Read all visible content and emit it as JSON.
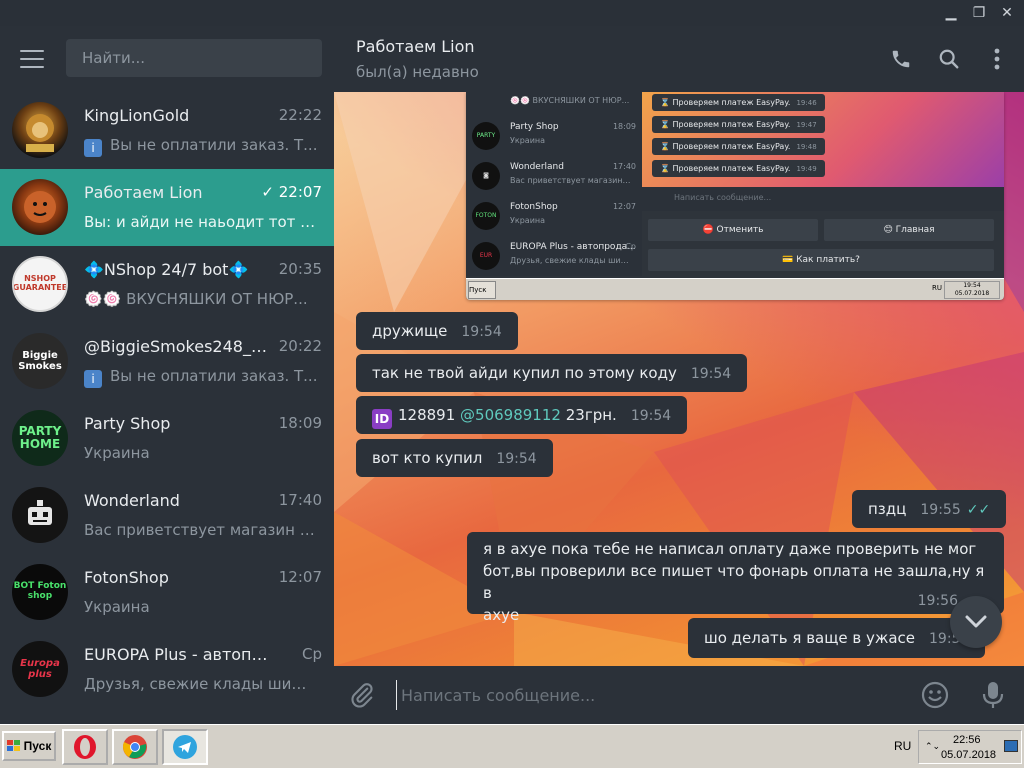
{
  "window": {
    "minimize": "▁",
    "maximize": "❐",
    "close": "✕"
  },
  "search": {
    "placeholder": "Найти..."
  },
  "chats": [
    {
      "name": "KingLionGold",
      "time": "22:22",
      "preview": "Вы не оплатили заказ. Т...",
      "badge": "i",
      "avatar_color": "#1a1410",
      "avatar_text": ""
    },
    {
      "name": "Работаем Lion",
      "time": "✓ 22:07",
      "preview": "Вы: и айди не наьодит тот чт...",
      "badge": "",
      "active": true,
      "avatar_color": "#3a1a0c",
      "avatar_text": ""
    },
    {
      "name": "💠NShop 24/7 bot💠",
      "time": "20:35",
      "preview": "🍥🍥 ВКУСНЯШКИ ОТ НЮР...",
      "badge": "",
      "avatar_color": "#f2f2f2",
      "avatar_text": "NSHOP GUARANTEE"
    },
    {
      "name": "@BiggieSmokes248_bot",
      "time": "20:22",
      "preview": "Вы не оплатили заказ. Т...",
      "badge": "i",
      "avatar_color": "#222222",
      "avatar_text": "Biggie Smokes"
    },
    {
      "name": "Party Shop",
      "time": "18:09",
      "preview": "Украина",
      "badge": "",
      "avatar_color": "#0f2a1a",
      "avatar_text": "PARTY HOME"
    },
    {
      "name": "Wonderland",
      "time": "17:40",
      "preview": "Вас приветствует магазин - ...",
      "badge": "",
      "avatar_color": "#0f0f0f",
      "avatar_text": ""
    },
    {
      "name": "FotonShop",
      "time": "12:07",
      "preview": "Украина",
      "badge": "",
      "avatar_color": "#0a0a0a",
      "avatar_text": "BOT Foton shop"
    },
    {
      "name": "EUROPA Plus - автопрода...",
      "time": "Ср",
      "preview": "Друзья, свежие клады шише...",
      "badge": "",
      "avatar_color": "#111111",
      "avatar_text": "Europa plus"
    }
  ],
  "header": {
    "title": "Работаем Lion",
    "status": "был(а) недавно"
  },
  "screenshot": {
    "list": [
      {
        "name": "",
        "sub": "🍥🍥 ВКУСНЯШКИ ОТ НЮР...",
        "time": ""
      },
      {
        "name": "Party Shop",
        "sub": "Украина",
        "time": "18:09"
      },
      {
        "name": "Wonderland",
        "sub": "Вас приветствует магазин - ...",
        "time": "17:40"
      },
      {
        "name": "FotonShop",
        "sub": "Украина",
        "time": "12:07"
      },
      {
        "name": "EUROPA Plus - автопрода...",
        "sub": "Друзья, свежие клады шише...",
        "time": "Ср"
      }
    ],
    "msgs": [
      {
        "text": "⌛ Проверяем платеж EasyPay.",
        "time": "19:46"
      },
      {
        "text": "⌛ Проверяем платеж EasyPay.",
        "time": "19:47"
      },
      {
        "text": "⌛ Проверяем платеж EasyPay.",
        "time": "19:48"
      },
      {
        "text": "⌛ Проверяем платеж EasyPay.",
        "time": "19:49"
      }
    ],
    "input_placeholder": "Написать сообщение...",
    "btn_cancel": "⛔ Отменить",
    "btn_main": "😊 Главная",
    "btn_pay": "💳 Как платить?",
    "tb_start": "Пуск",
    "tb_ru": "RU",
    "tb_time": "19:54",
    "tb_date": "05.07.2018"
  },
  "messages": [
    {
      "text": "дружище",
      "time": "19:54"
    },
    {
      "text": "так не твой айди купил по этому коду",
      "time": "19:54"
    },
    {
      "id_badge": "ID",
      "num": "128891",
      "mention": "@506989112",
      "suffix": "23грн.",
      "time": "19:54"
    },
    {
      "text": "вот кто купил",
      "time": "19:54"
    },
    {
      "text": "пздц",
      "time": "19:55",
      "out": true
    },
    {
      "line1": "я в ахуе пока тебе не написал оплату даже проверить не мог",
      "line2": "бот,вы проверили все пишет что фонарь оплата не зашла,ну я в",
      "line3": "ахуе",
      "time": "19:56",
      "out": true
    },
    {
      "text": "шо делать я ваще в ужасе",
      "time": "19:57",
      "out": true
    }
  ],
  "composer": {
    "placeholder": "Написать сообщение..."
  },
  "taskbar": {
    "start": "Пуск",
    "lang": "RU",
    "time": "22:56",
    "date": "05.07.2018",
    "arrows": "⌃⌄"
  },
  "colors": {
    "accent": "#2c9d8e",
    "sidebar": "#2b3139",
    "bubble": "#2b3139",
    "mention": "#5fc9bd"
  }
}
